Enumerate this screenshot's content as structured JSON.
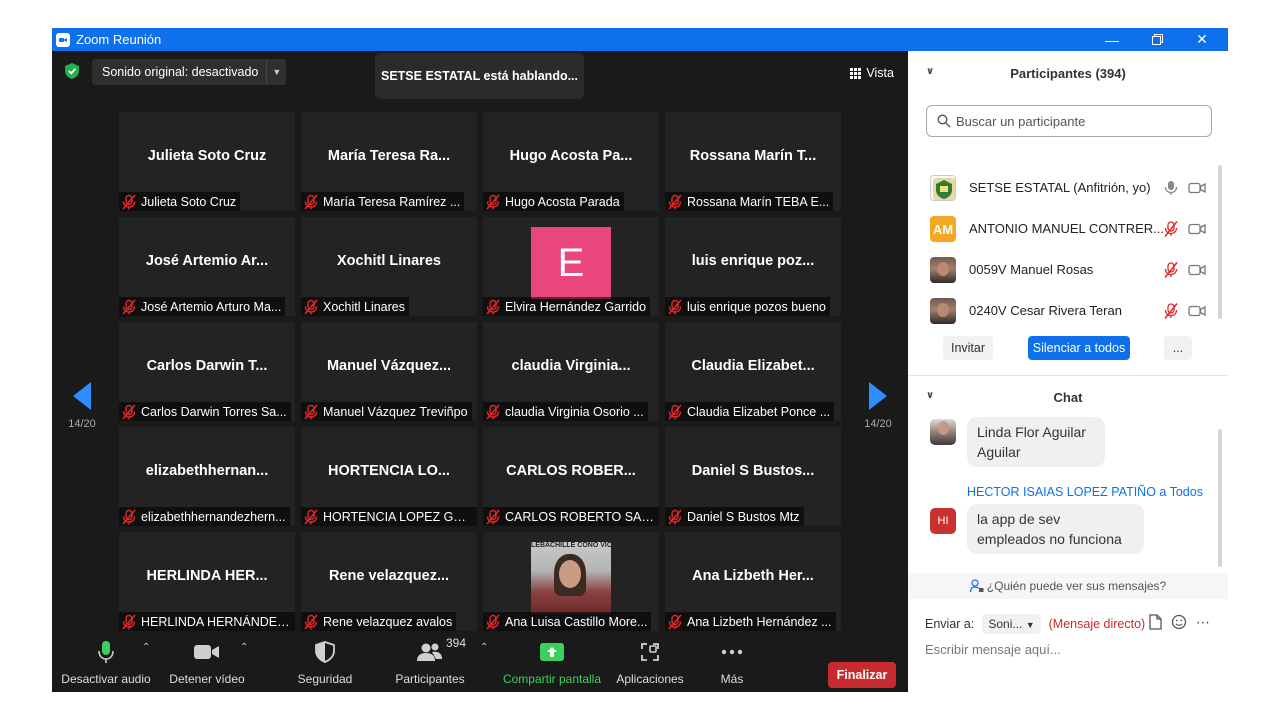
{
  "window": {
    "title": "Zoom Reunión"
  },
  "top": {
    "sound_label": "Sonido original: desactivado",
    "speaking": "SETSE ESTATAL está hablando...",
    "view_label": "Vista"
  },
  "nav": {
    "left_page": "14/20",
    "right_page": "14/20"
  },
  "tiles": [
    {
      "big": "Julieta Soto Cruz",
      "label": "Julieta Soto Cruz"
    },
    {
      "big": "María Teresa Ra...",
      "label": "María Teresa Ramírez ..."
    },
    {
      "big": "Hugo Acosta Pa...",
      "label": "Hugo Acosta Parada"
    },
    {
      "big": "Rossana Marín T...",
      "label": "Rossana Marín TEBA E..."
    },
    {
      "big": "José Artemio Ar...",
      "label": "José Artemio Arturo Ma..."
    },
    {
      "big": "Xochitl Linares",
      "label": "Xochitl Linares"
    },
    {
      "big": "",
      "label": "Elvira Hernández Garrido",
      "avatar_letter": "E",
      "avatar_color": "#e8467c"
    },
    {
      "big": "luis enrique poz...",
      "label": "luis enrique pozos bueno"
    },
    {
      "big": "Carlos Darwin T...",
      "label": "Carlos Darwin Torres Sa..."
    },
    {
      "big": "Manuel  Vázquez...",
      "label": "Manuel Vázquez Treviñpo"
    },
    {
      "big": "claudia  Virginia...",
      "label": "claudia Virginia Osorio ..."
    },
    {
      "big": "Claudia  Elizabet...",
      "label": "Claudia Elizabet Ponce ..."
    },
    {
      "big": "elizabethhernan...",
      "label": "elizabethhernandezhern..."
    },
    {
      "big": "HORTENCIA  LO...",
      "label": "HORTENCIA LOPEZ GOD..."
    },
    {
      "big": "CARLOS  ROBER...",
      "label": "CARLOS ROBERTO SALO..."
    },
    {
      "big": "Daniel S Bustos...",
      "label": "Daniel S Bustos Mtz"
    },
    {
      "big": "HERLINDA  HER...",
      "label": "HERLINDA HERNÁNDEZ..."
    },
    {
      "big": "Rene  velazquez...",
      "label": "Rene velazquez avalos"
    },
    {
      "big": "",
      "label": "Ana Luisa Castillo More...",
      "photo_banner": "LEBACHILLE    CONO  VICEN      ERR"
    },
    {
      "big": "Ana Lizbeth  Her...",
      "label": "Ana Lizbeth Hernández ..."
    }
  ],
  "toolbar": {
    "audio": "Desactivar audio",
    "video": "Detener vídeo",
    "security": "Seguridad",
    "participants": "Participantes",
    "participants_count": "394",
    "share": "Compartir pantalla",
    "apps": "Aplicaciones",
    "more": "Más",
    "end": "Finalizar"
  },
  "participants_panel": {
    "title": "Participantes (394)",
    "search_placeholder": "Buscar un participante",
    "rows": [
      {
        "name": "SETSE ESTATAL (Anfitrión, yo)",
        "avatar": "logo",
        "mic": "on"
      },
      {
        "name": "ANTONIO MANUEL CONTRER...",
        "avatar": "AM",
        "avatar_color": "#f5a623",
        "mic": "muted"
      },
      {
        "name": "0059V Manuel Rosas",
        "avatar": "photo",
        "mic": "muted"
      },
      {
        "name": "0240V Cesar Rivera Teran",
        "avatar": "photo",
        "mic": "muted"
      }
    ],
    "invite": "Invitar",
    "mute_all": "Silenciar a todos",
    "more": "..."
  },
  "chat": {
    "title": "Chat",
    "messages": [
      {
        "sender": "",
        "text_line1": "Linda Flor Aguilar",
        "text_line2": "Aguilar"
      },
      {
        "sender": "HECTOR ISAIAS LOPEZ PATIÑO a Todos",
        "avatar": "HI",
        "avatar_color": "#c9312f",
        "text_line1": "la app de sev",
        "text_line2": "empleados no funciona"
      }
    ],
    "who_can_see": "¿Quién puede ver sus mensajes?",
    "send_to_label": "Enviar a:",
    "send_to_value": "Soni...",
    "direct_message": "(Mensaje directo)",
    "input_placeholder": "Escribir mensaje aquí..."
  }
}
